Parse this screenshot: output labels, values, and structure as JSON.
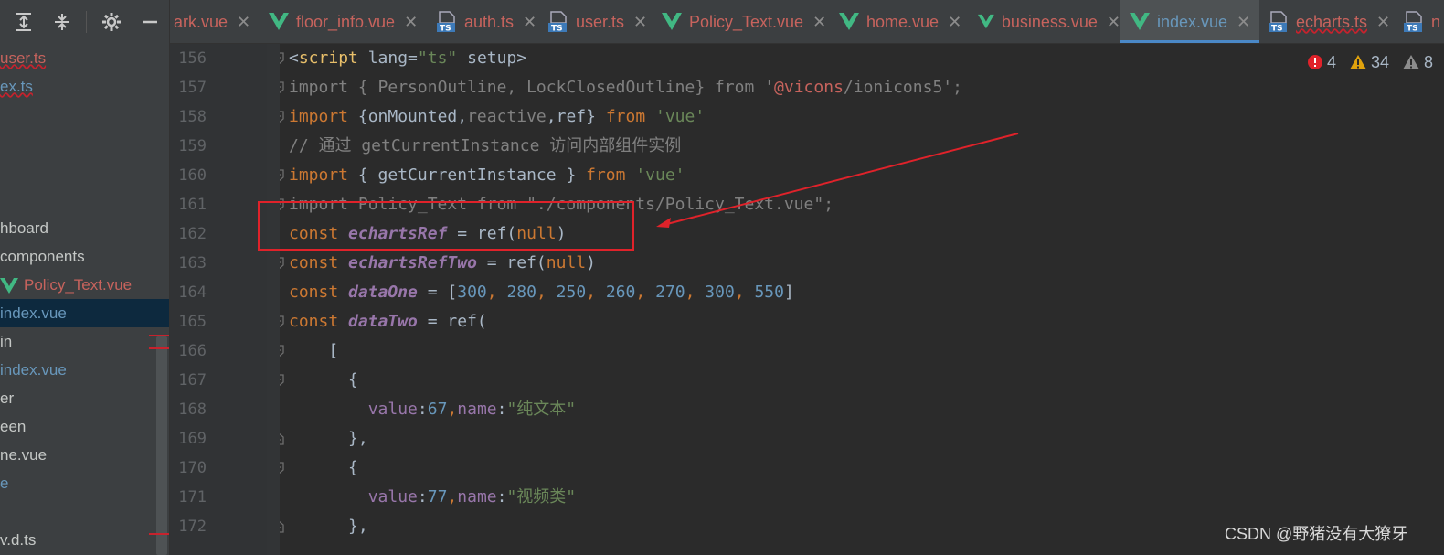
{
  "sidebar": {
    "toolbar": {
      "expand_icon": "expand-all-icon",
      "collapse_icon": "collapse-all-icon",
      "settings_icon": "gear-icon",
      "hide_icon": "minimize-icon"
    },
    "items": [
      {
        "label": "user.ts",
        "color": "#c7635d",
        "underline": true
      },
      {
        "label": "ex.ts",
        "color": "#6897bb",
        "underline": true
      },
      {
        "label": "",
        "color": "#a9b7c6"
      },
      {
        "label": "",
        "color": "#a9b7c6"
      },
      {
        "label": "",
        "color": "#a9b7c6"
      },
      {
        "label": "hboard",
        "color": "#c5c8c6"
      },
      {
        "label": "components",
        "color": "#c5c8c6"
      },
      {
        "label": "Policy_Text.vue",
        "color": "#c7635d",
        "vue_icon": true
      },
      {
        "label": "index.vue",
        "color": "#6897bb",
        "selected": true
      },
      {
        "label": "in",
        "color": "#c5c8c6"
      },
      {
        "label": "index.vue",
        "color": "#6897bb"
      },
      {
        "label": "er",
        "color": "#c5c8c6"
      },
      {
        "label": "een",
        "color": "#c5c8c6"
      },
      {
        "label": "ne.vue",
        "color": "#c5c8c6"
      },
      {
        "label": "e",
        "color": "#6897bb"
      },
      {
        "label": "",
        "color": "#a9b7c6"
      },
      {
        "label": "v.d.ts",
        "color": "#c5c8c6"
      }
    ]
  },
  "tabs": [
    {
      "label": "ark.vue",
      "icon": "none",
      "color": "#c7635d"
    },
    {
      "label": "floor_info.vue",
      "icon": "vue-icon",
      "color": "#c7635d"
    },
    {
      "label": "auth.ts",
      "icon": "ts-icon",
      "color": "#c7635d"
    },
    {
      "label": "user.ts",
      "icon": "ts-icon",
      "color": "#c7635d"
    },
    {
      "label": "Policy_Text.vue",
      "icon": "vue-icon",
      "color": "#c7635d"
    },
    {
      "label": "home.vue",
      "icon": "vue-icon",
      "color": "#c7635d"
    },
    {
      "label": "business.vue",
      "icon": "vue-icon",
      "color": "#c7635d"
    },
    {
      "label": "index.vue",
      "icon": "vue-icon",
      "color": "#6897bb",
      "active": true
    },
    {
      "label": "echarts.ts",
      "icon": "ts-icon",
      "color": "#c7635d",
      "underline": true
    },
    {
      "label": "n",
      "icon": "ts-icon",
      "color": "#c7635d"
    }
  ],
  "inspections": {
    "errors": "4",
    "warnings": "34",
    "weak_warnings": "8"
  },
  "line_numbers": [
    "156",
    "157",
    "158",
    "159",
    "160",
    "161",
    "162",
    "163",
    "164",
    "165",
    "166",
    "167",
    "168",
    "169",
    "170",
    "171",
    "172"
  ],
  "code": {
    "l156": {
      "open": "<",
      "tag": "script",
      "attr": " lang=",
      "val": "\"ts\"",
      "rest": " setup",
      "close": ">"
    },
    "l157": {
      "kw": "import",
      "body": " { PersonOutline, LockClosedOutline} ",
      "from": "from",
      "s1": " '",
      "anno": "@vicons",
      "s2": "/ionicons5';"
    },
    "l158": {
      "kw": "import",
      "b1": " {onMounted,",
      "dim": "reactive",
      "b2": ",ref} ",
      "from": "from",
      "str": " 'vue'"
    },
    "l159": {
      "comment": "// 通过 getCurrentInstance 访问内部组件实例"
    },
    "l160": {
      "kw": "import",
      "body": " { getCurrentInstance } ",
      "from": "from",
      "str": " 'vue'"
    },
    "l161": {
      "text": "import Policy_Text from \"./components/Policy_Text.vue\";"
    },
    "l162": {
      "kw": "const",
      "var": " echartsRef",
      "eq": " = ref(",
      "nul": "null",
      "end": ")"
    },
    "l163": {
      "kw": "const",
      "var": " echartsRefTwo",
      "eq": " = ref(",
      "nul": "null",
      "end": ")"
    },
    "l164": {
      "kw": "const",
      "var": " dataOne",
      "eq": " = [",
      "nums": [
        "300",
        "280",
        "250",
        "260",
        "270",
        "300",
        "550"
      ],
      "end": "]"
    },
    "l165": {
      "kw": "const",
      "var": " dataTwo",
      "eq": " = ref("
    },
    "l166": {
      "text": "    ["
    },
    "l167": {
      "text": "      {"
    },
    "l168": {
      "prop1": "value",
      "colon1": ":",
      "num": "67",
      "comma": ",",
      "prop2": "name",
      "colon2": ":",
      "str": "\"纯文本\""
    },
    "l169": {
      "text": "      },"
    },
    "l170": {
      "text": "      {"
    },
    "l171": {
      "prop1": "value",
      "colon1": ":",
      "num": "77",
      "comma": ",",
      "prop2": "name",
      "colon2": ":",
      "str": "\"视频类\""
    },
    "l172": {
      "text": "      },"
    }
  },
  "watermark": "CSDN @野猪没有大獠牙",
  "colors": {
    "annotation": "#e0222a",
    "accent": "#4a88c7"
  }
}
